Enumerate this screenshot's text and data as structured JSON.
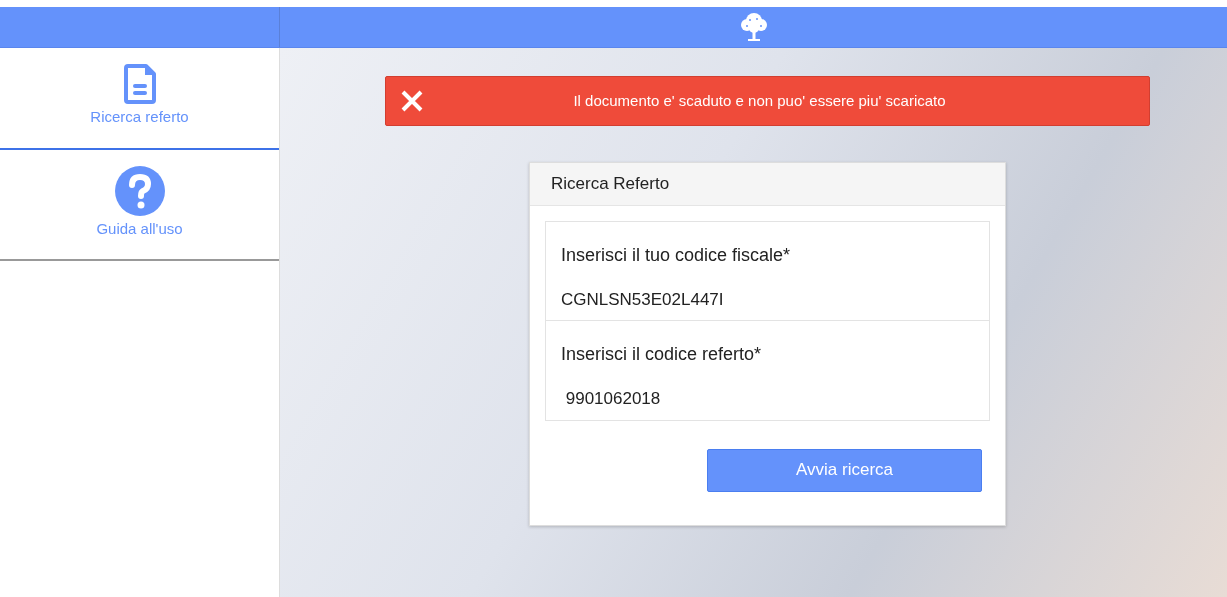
{
  "sidebar": {
    "items": [
      {
        "label": "Ricerca referto",
        "selected": true
      },
      {
        "label": "Guida all'uso",
        "selected": false
      }
    ]
  },
  "alert": {
    "kind": "error",
    "message": "Il documento e' scaduto e non puo' essere piu' scaricato"
  },
  "form": {
    "title": "Ricerca Referto",
    "fields": [
      {
        "label": "Inserisci il tuo codice fiscale*",
        "value": "CGNLSN53E02L447I"
      },
      {
        "label": "Inserisci il codice referto*",
        "value": " 9901062018"
      }
    ],
    "button": "Avvia ricerca"
  }
}
